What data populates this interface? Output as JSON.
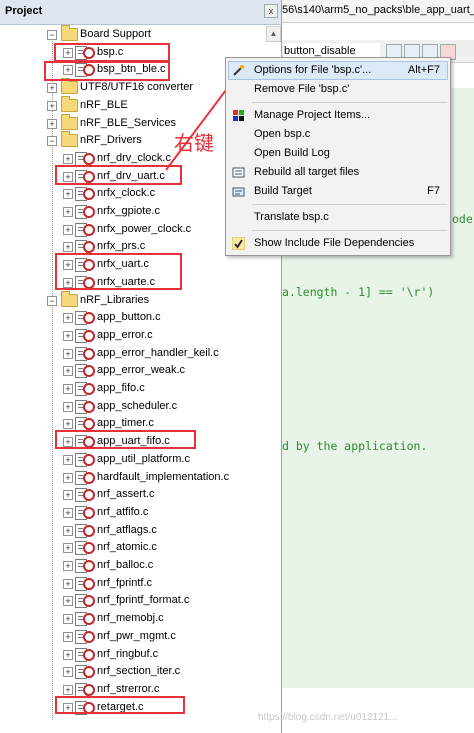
{
  "panel": {
    "title": "Project",
    "close_glyph": "x"
  },
  "editor": {
    "path": "56\\s140\\arm5_no_packs\\ble_app_uart_pc",
    "combo": "button_disable",
    "code_lines": [
      {
        "text": "ode"
      },
      {
        "text": "a.length - 1] == '\\r')"
      },
      {
        "text": "d by the application."
      }
    ],
    "watermark": "https://blog.csdn.net/u012121..."
  },
  "annotation": "右键",
  "tree": {
    "groups": [
      {
        "name": "Board Support",
        "files": [
          "bsp.c",
          "bsp_btn_ble.c"
        ]
      },
      {
        "name": "UTF8/UTF16 converter",
        "files": []
      },
      {
        "name": "nRF_BLE",
        "files": []
      },
      {
        "name": "nRF_BLE_Services",
        "files": []
      },
      {
        "name": "nRF_Drivers",
        "files": [
          "nrf_drv_clock.c",
          "nrf_drv_uart.c",
          "nrfx_clock.c",
          "nrfx_gpiote.c",
          "nrfx_power_clock.c",
          "nrfx_prs.c",
          "nrfx_uart.c",
          "nrfx_uarte.c"
        ]
      },
      {
        "name": "nRF_Libraries",
        "files": [
          "app_button.c",
          "app_error.c",
          "app_error_handler_keil.c",
          "app_error_weak.c",
          "app_fifo.c",
          "app_scheduler.c",
          "app_timer.c",
          "app_uart_fifo.c",
          "app_util_platform.c",
          "hardfault_implementation.c",
          "nrf_assert.c",
          "nrf_atfifo.c",
          "nrf_atflags.c",
          "nrf_atomic.c",
          "nrf_balloc.c",
          "nrf_fprintf.c",
          "nrf_fprintf_format.c",
          "nrf_memobj.c",
          "nrf_pwr_mgmt.c",
          "nrf_ringbuf.c",
          "nrf_section_iter.c",
          "nrf_strerror.c",
          "retarget.c"
        ]
      }
    ]
  },
  "context_menu": {
    "items": [
      {
        "label": "Options for File 'bsp.c'...",
        "shortcut": "Alt+F7",
        "icon": "wand-icon"
      },
      {
        "label": "Remove File 'bsp.c'",
        "shortcut": "",
        "icon": ""
      },
      {
        "label": "Manage Project Items...",
        "shortcut": "",
        "icon": "manage-items-icon"
      },
      {
        "label": "Open bsp.c",
        "shortcut": "",
        "icon": ""
      },
      {
        "label": "Open Build Log",
        "shortcut": "",
        "icon": ""
      },
      {
        "label": "Rebuild all target files",
        "shortcut": "",
        "icon": "rebuild-icon"
      },
      {
        "label": "Build Target",
        "shortcut": "F7",
        "icon": "build-icon"
      },
      {
        "label": "Translate bsp.c",
        "shortcut": "",
        "icon": ""
      },
      {
        "label": "Show Include File Dependencies",
        "shortcut": "",
        "icon": "checkmark-icon"
      }
    ]
  },
  "colors": {
    "highlight_box": "#e8323a",
    "code_green": "#2e8b2e",
    "menu_hover": "#dce9f7"
  }
}
